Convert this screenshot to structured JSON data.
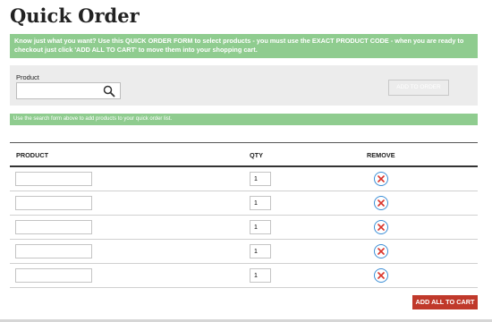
{
  "page": {
    "title": "Quick Order"
  },
  "info_banner": {
    "text": "Know just what you want? Use this QUICK ORDER FORM to select products - you must use the EXACT PRODUCT CODE - when you are ready to checkout just click 'ADD ALL TO CART' to move them into your shopping cart."
  },
  "search": {
    "label": "Product",
    "value": "",
    "placeholder": "",
    "icon": "search-icon",
    "add_button_label": "ADD TO ORDER"
  },
  "hint_banner": {
    "text": "Use the search form above to add products to your quick order list."
  },
  "table": {
    "headers": {
      "product": "PRODUCT",
      "qty": "QTY",
      "remove": "REMOVE"
    },
    "rows": [
      {
        "product": "",
        "qty": "1"
      },
      {
        "product": "",
        "qty": "1"
      },
      {
        "product": "",
        "qty": "1"
      },
      {
        "product": "",
        "qty": "1"
      },
      {
        "product": "",
        "qty": "1"
      }
    ]
  },
  "footer": {
    "add_all_label": "ADD ALL TO CART"
  },
  "colors": {
    "banner_green": "#8fcc8f",
    "panel_gray": "#ececec",
    "cart_button_red": "#c0392b",
    "remove_icon_blue": "#3d8fd6",
    "remove_icon_red": "#d9342b"
  }
}
